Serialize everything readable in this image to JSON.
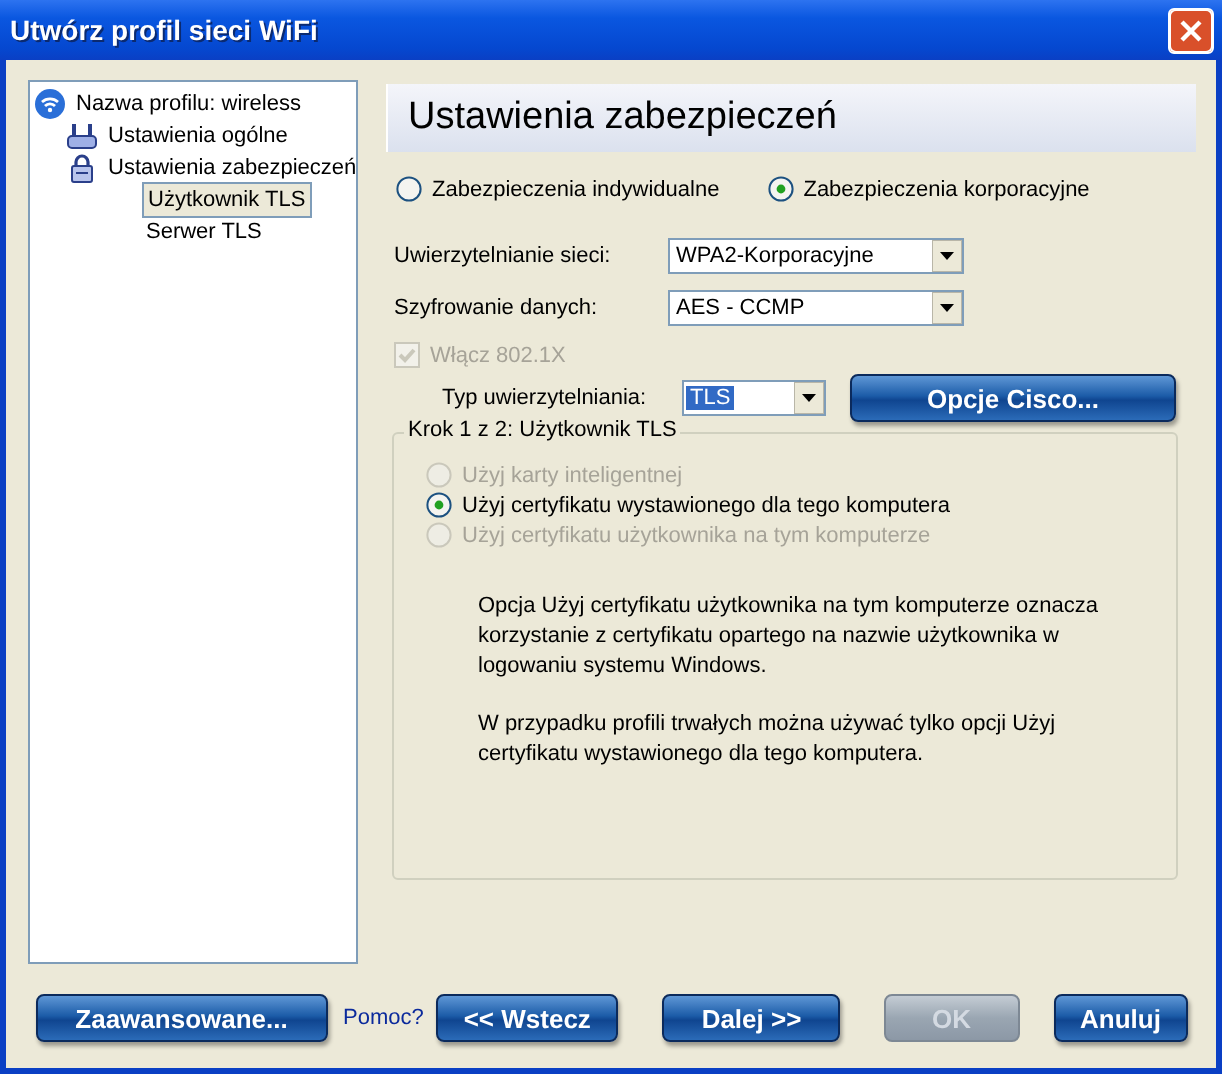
{
  "window": {
    "title": "Utwórz profil sieci WiFi"
  },
  "tree": [
    {
      "label": "Nazwa profilu: wireless",
      "kind": "wifi",
      "selected": false,
      "children": [
        {
          "label": "Ustawienia ogólne",
          "kind": "router",
          "selected": false
        },
        {
          "label": "Ustawienia zabezpieczeń",
          "kind": "lock",
          "selected": false,
          "children": [
            {
              "label": "Użytkownik TLS",
              "selected": true
            },
            {
              "label": "Serwer TLS",
              "selected": false
            }
          ]
        }
      ]
    }
  ],
  "header": "Ustawienia zabezpieczeń",
  "security_mode": [
    {
      "label": "Zabezpieczenia indywidualne",
      "selected": false
    },
    {
      "label": "Zabezpieczenia korporacyjne",
      "selected": true
    }
  ],
  "fields": [
    {
      "label": "Uwierzytelnianie sieci:",
      "value": "WPA2-Korporacyjne"
    },
    {
      "label": "Szyfrowanie danych:",
      "value": "AES - CCMP"
    }
  ],
  "enable_8021x": {
    "label": "Włącz 802.1X",
    "checked": true,
    "disabled": true
  },
  "auth_type": {
    "label": "Typ uwierzytelniania:",
    "value": "TLS"
  },
  "cisco_button": {
    "label": "Opcje Cisco..."
  },
  "step_group": {
    "title": "Krok 1 z 2: Użytkownik TLS",
    "options": [
      {
        "label": "Użyj karty inteligentnej",
        "selected": false,
        "disabled": true
      },
      {
        "label": "Użyj certyfikatu wystawionego dla tego komputera",
        "selected": true,
        "disabled": false
      },
      {
        "label": "Użyj certyfikatu użytkownika na tym komputerze",
        "selected": false,
        "disabled": true
      }
    ],
    "paragraphs": [
      "Opcja Użyj certyfikatu użytkownika na tym komputerze oznacza korzystanie z certyfikatu opartego na nazwie użytkownika w logowaniu systemu Windows.",
      "W przypadku profili trwałych można używać tylko opcji Użyj certyfikatu wystawionego dla tego komputera."
    ]
  },
  "buttons": [
    {
      "label": "Zaawansowane...",
      "kind": "button",
      "disabled": false
    },
    {
      "label": "Pomoc?",
      "kind": "link"
    },
    {
      "label": "<< Wstecz",
      "kind": "button",
      "disabled": false
    },
    {
      "label": "Dalej >>",
      "kind": "button",
      "disabled": false
    },
    {
      "label": "OK",
      "kind": "button",
      "disabled": true
    },
    {
      "label": "Anuluj",
      "kind": "button",
      "disabled": false
    }
  ]
}
